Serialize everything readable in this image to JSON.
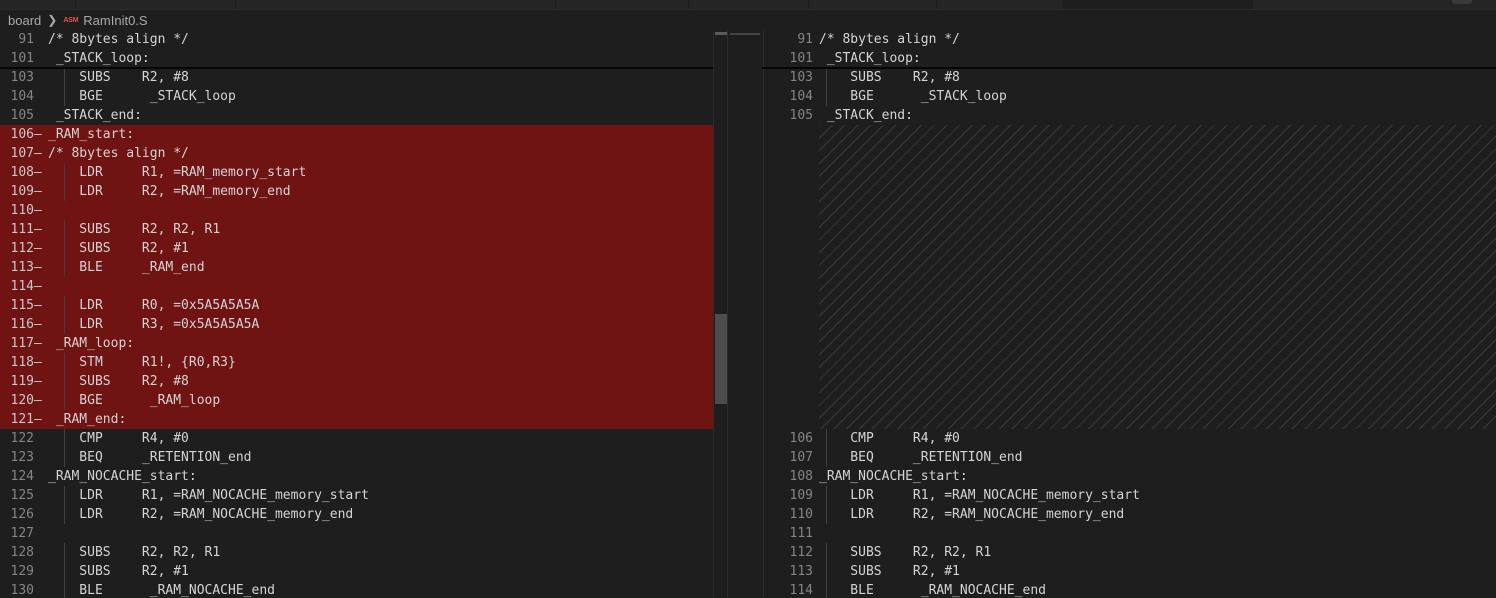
{
  "breadcrumb": {
    "folder": "board",
    "file_icon": "ASM",
    "file": "RamInit0.S"
  },
  "colors": {
    "removed_bg": "#6f1313",
    "editor_bg": "#1e1e1e",
    "line_number": "#858585",
    "text": "#d4d4d4"
  },
  "left_editor": {
    "lines": [
      {
        "num": "91",
        "mark": "",
        "code": "/* 8bytes align */",
        "removed": false,
        "sticky": true
      },
      {
        "num": "101",
        "mark": "",
        "code": " _STACK_loop:",
        "removed": false,
        "sticky": true
      },
      {
        "num": "103",
        "mark": "",
        "code": "    SUBS    R2, #8",
        "removed": false
      },
      {
        "num": "104",
        "mark": "",
        "code": "    BGE      _STACK_loop",
        "removed": false
      },
      {
        "num": "105",
        "mark": "",
        "code": " _STACK_end:",
        "removed": false
      },
      {
        "num": "106",
        "mark": "—",
        "code": "_RAM_start:",
        "removed": true
      },
      {
        "num": "107",
        "mark": "—",
        "code": "/* 8bytes align */",
        "removed": true
      },
      {
        "num": "108",
        "mark": "—",
        "code": "    LDR     R1, =RAM_memory_start",
        "removed": true
      },
      {
        "num": "109",
        "mark": "—",
        "code": "    LDR     R2, =RAM_memory_end",
        "removed": true
      },
      {
        "num": "110",
        "mark": "—",
        "code": "",
        "removed": true
      },
      {
        "num": "111",
        "mark": "—",
        "code": "    SUBS    R2, R2, R1",
        "removed": true
      },
      {
        "num": "112",
        "mark": "—",
        "code": "    SUBS    R2, #1",
        "removed": true
      },
      {
        "num": "113",
        "mark": "—",
        "code": "    BLE     _RAM_end",
        "removed": true
      },
      {
        "num": "114",
        "mark": "—",
        "code": "",
        "removed": true
      },
      {
        "num": "115",
        "mark": "—",
        "code": "    LDR     R0, =0x5A5A5A5A",
        "removed": true
      },
      {
        "num": "116",
        "mark": "—",
        "code": "    LDR     R3, =0x5A5A5A5A",
        "removed": true
      },
      {
        "num": "117",
        "mark": "—",
        "code": " _RAM_loop:",
        "removed": true
      },
      {
        "num": "118",
        "mark": "—",
        "code": "    STM     R1!, {R0,R3}",
        "removed": true
      },
      {
        "num": "119",
        "mark": "—",
        "code": "    SUBS    R2, #8",
        "removed": true
      },
      {
        "num": "120",
        "mark": "—",
        "code": "    BGE      _RAM_loop",
        "removed": true
      },
      {
        "num": "121",
        "mark": "—",
        "code": " _RAM_end:",
        "removed": true
      },
      {
        "num": "122",
        "mark": "",
        "code": "    CMP     R4, #0",
        "removed": false
      },
      {
        "num": "123",
        "mark": "",
        "code": "    BEQ     _RETENTION_end",
        "removed": false
      },
      {
        "num": "124",
        "mark": "",
        "code": "_RAM_NOCACHE_start:",
        "removed": false
      },
      {
        "num": "125",
        "mark": "",
        "code": "    LDR     R1, =RAM_NOCACHE_memory_start",
        "removed": false
      },
      {
        "num": "126",
        "mark": "",
        "code": "    LDR     R2, =RAM_NOCACHE_memory_end",
        "removed": false
      },
      {
        "num": "127",
        "mark": "",
        "code": "",
        "removed": false
      },
      {
        "num": "128",
        "mark": "",
        "code": "    SUBS    R2, R2, R1",
        "removed": false
      },
      {
        "num": "129",
        "mark": "",
        "code": "    SUBS    R2, #1",
        "removed": false
      },
      {
        "num": "130",
        "mark": "",
        "code": "    BLE      _RAM_NOCACHE_end",
        "removed": false
      }
    ]
  },
  "right_editor": {
    "lines": [
      {
        "num": "91",
        "code": "/* 8bytes align */",
        "sticky": true
      },
      {
        "num": "101",
        "code": " _STACK_loop:",
        "sticky": true
      },
      {
        "num": "103",
        "code": "    SUBS    R2, #8"
      },
      {
        "num": "104",
        "code": "    BGE      _STACK_loop"
      },
      {
        "num": "105",
        "code": " _STACK_end:"
      },
      {
        "filler": 16
      },
      {
        "num": "106",
        "code": "    CMP     R4, #0"
      },
      {
        "num": "107",
        "code": "    BEQ     _RETENTION_end"
      },
      {
        "num": "108",
        "code": "_RAM_NOCACHE_start:"
      },
      {
        "num": "109",
        "code": "    LDR     R1, =RAM_NOCACHE_memory_start"
      },
      {
        "num": "110",
        "code": "    LDR     R2, =RAM_NOCACHE_memory_end"
      },
      {
        "num": "111",
        "code": ""
      },
      {
        "num": "112",
        "code": "    SUBS    R2, R2, R1"
      },
      {
        "num": "113",
        "code": "    SUBS    R2, #1"
      },
      {
        "num": "114",
        "code": "    BLE      _RAM_NOCACHE_end"
      }
    ]
  }
}
